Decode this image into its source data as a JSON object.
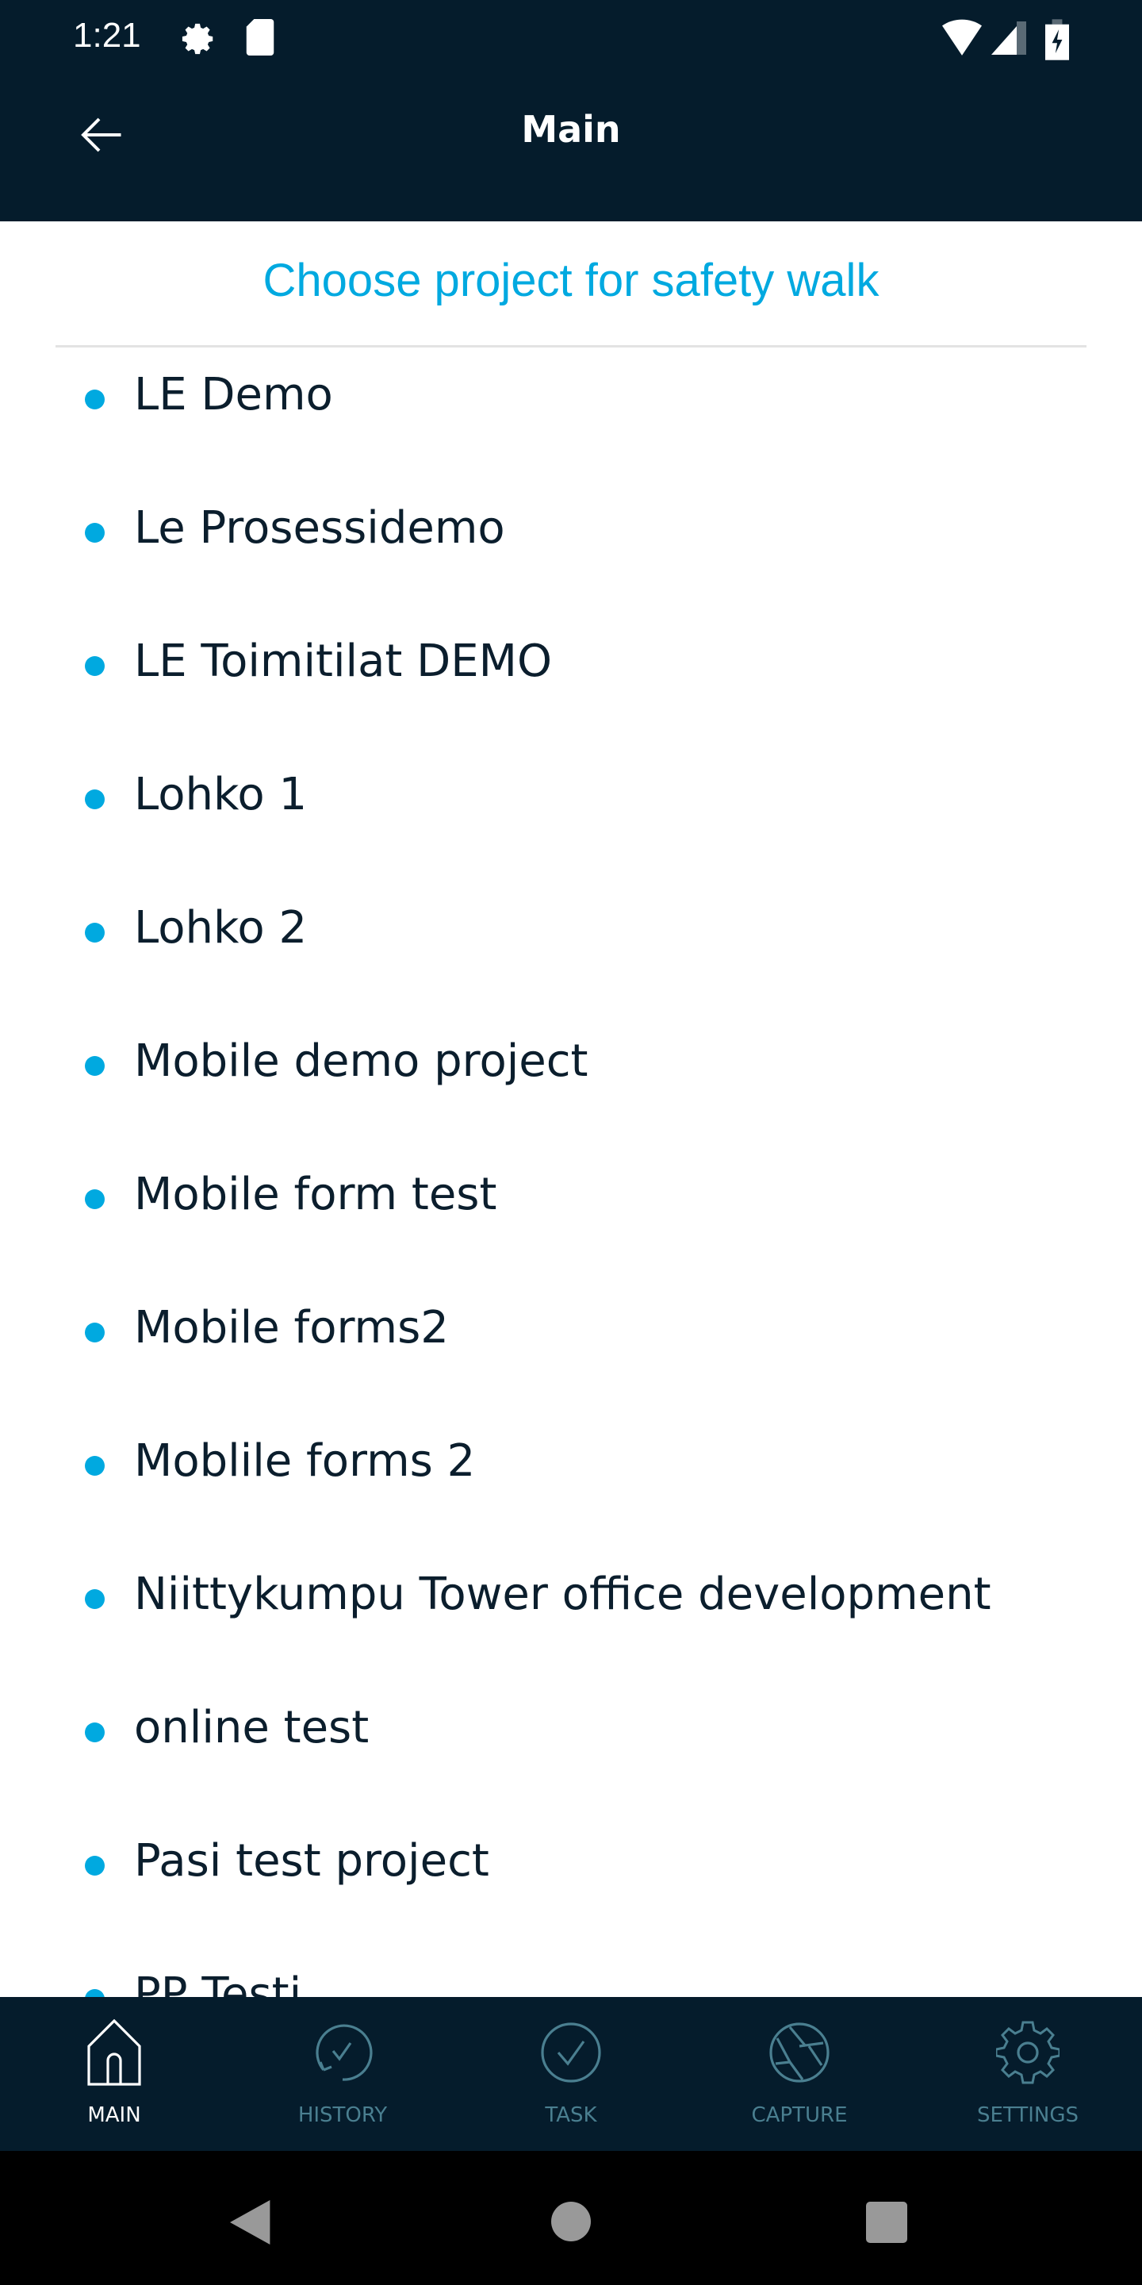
{
  "status_bar": {
    "time": "1:21",
    "icons": [
      "settings-icon",
      "sd-card-icon",
      "wifi-icon",
      "signal-icon",
      "battery-charging-icon"
    ]
  },
  "header": {
    "title": "Main",
    "back_icon": "arrow-left-icon"
  },
  "subtitle": "Choose project for safety walk",
  "projects": [
    "LE Demo",
    "Le Prosessidemo",
    "LE Toimitilat DEMO",
    "Lohko 1",
    "Lohko 2",
    "Mobile demo project",
    "Mobile form test",
    "Mobile forms2",
    "Moblile forms 2",
    "Niittykumpu Tower office development",
    "online test",
    "Pasi test project",
    "PP Testi"
  ],
  "bottom_nav": [
    {
      "label": "MAIN",
      "icon": "home-icon",
      "active": true
    },
    {
      "label": "HISTORY",
      "icon": "history-icon"
    },
    {
      "label": "TASK",
      "icon": "task-check-icon"
    },
    {
      "label": "CAPTURE",
      "icon": "camera-aperture-icon"
    },
    {
      "label": "SETTINGS",
      "icon": "gear-icon"
    }
  ],
  "colors": {
    "header": "#051c2c",
    "accent": "#00a9e0",
    "text": "#0b1e2d",
    "inactive": "#4a7f90"
  }
}
